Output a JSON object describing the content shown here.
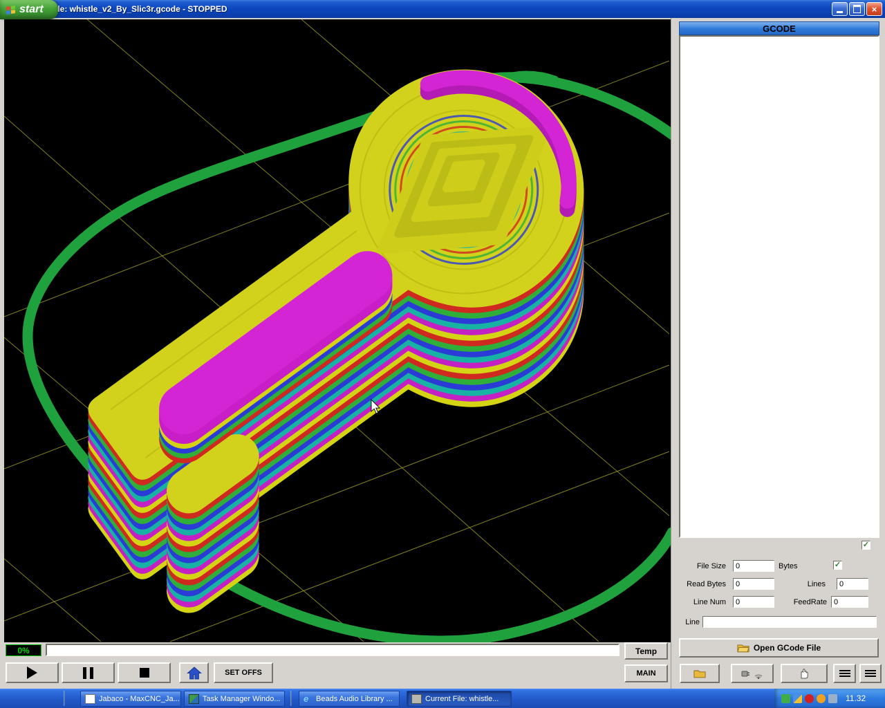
{
  "titlebar": {
    "title": "Current File:  whistle_v2_By_Slic3r.gcode   -   STOPPED"
  },
  "viewport": {
    "colors": {
      "bed_grid": "#9a9a22",
      "skirt": "#1fa23e",
      "top": "#d2d21c",
      "detail": "#b9b913",
      "cycle": [
        "#cf2a1f",
        "#2fae3a",
        "#2b3bd6",
        "#17b2a4",
        "#c421c4",
        "#d4d414"
      ],
      "magenta_top": "#d425d4",
      "bar_cycle": [
        "#c81ec8",
        "#c81ec8",
        "#d4d414",
        "#2b3bd6",
        "#2fae3a",
        "#cf2a1f"
      ],
      "pyramid": [
        "#cdcd1a",
        "#bcbc16"
      ]
    }
  },
  "gcode_panel": {
    "header": "GCODE",
    "file_size_label": "File Size",
    "file_size_value": "0",
    "bytes_label": "Bytes",
    "read_bytes_label": "Read Bytes",
    "read_bytes_value": "0",
    "lines_label": "Lines",
    "lines_value": "0",
    "line_num_label": "Line Num",
    "line_num_value": "0",
    "feedrate_label": "FeedRate",
    "feedrate_value": "0",
    "line_label": "Line",
    "line_value": "",
    "open_button_label": "Open GCode File"
  },
  "transport": {
    "progress_label": "0%",
    "line_display_value": "",
    "temp_label": "Temp",
    "main_label": "MAIN",
    "set_offs_label": "SET OFFS"
  },
  "taskbar": {
    "start_label": "start",
    "tasks": [
      {
        "label": "Jabaco - MaxCNC_Ja..."
      },
      {
        "label": "Task Manager Windo..."
      },
      {
        "label": "Beads Audio Library ..."
      },
      {
        "label": "Current File:  whistle..."
      }
    ],
    "clock": "11.32"
  }
}
